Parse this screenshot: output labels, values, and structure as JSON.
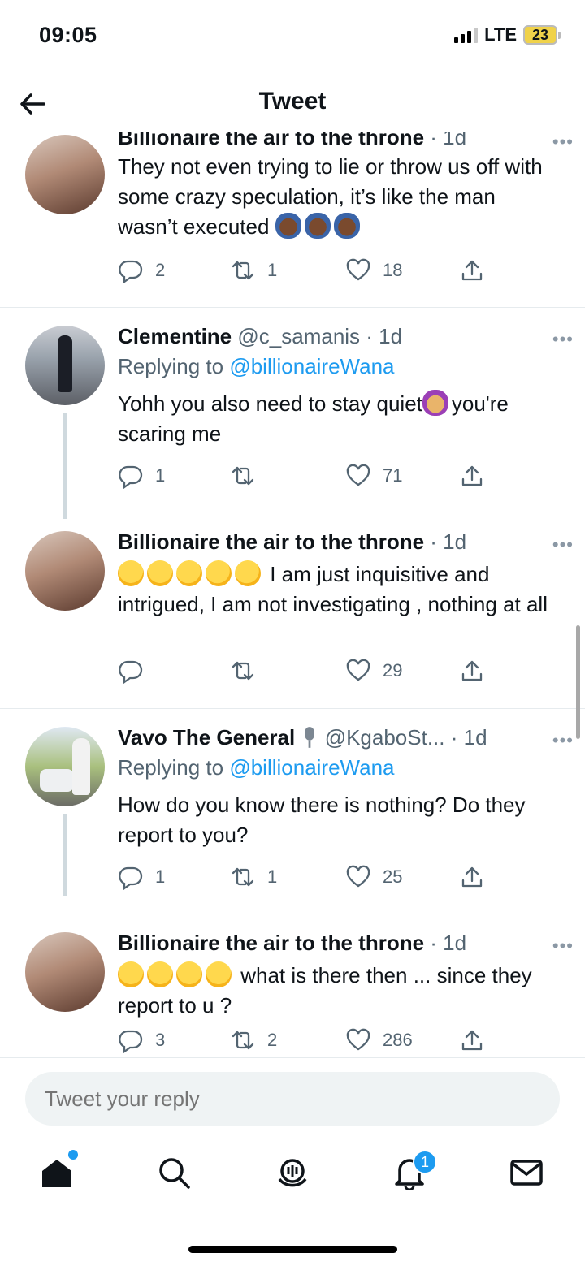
{
  "status_bar": {
    "time": "09:05",
    "network": "LTE",
    "battery": "23"
  },
  "header": {
    "title": "Tweet"
  },
  "tweets": [
    {
      "name": "Billionaire the air to the throne",
      "handle": "",
      "time": "· 1d",
      "replying_to_label": "",
      "replying_to_handle": "",
      "text": "They not even trying to lie or throw us off with some crazy speculation, it’s like the man wasn’t executed",
      "replies": "2",
      "retweets": "1",
      "likes": "18"
    },
    {
      "name": "Clementine",
      "handle": "@c_samanis",
      "time": "· 1d",
      "replying_to_label": "Replying to",
      "replying_to_handle": "@billionaireWana",
      "text_before": "Yohh you also need to stay quiet",
      "text_after": "you're scaring me",
      "replies": "1",
      "retweets": "",
      "likes": "71"
    },
    {
      "name": "Billionaire the air to the throne",
      "handle": "",
      "time": "· 1d",
      "text": "I am just inquisitive and intrigued, I am not investigating , nothing at all",
      "replies": "",
      "retweets": "",
      "likes": "29"
    },
    {
      "name": "Vavo The General",
      "handle": "@KgaboSt...",
      "time": "· 1d",
      "replying_to_label": "Replying to",
      "replying_to_handle": "@billionaireWana",
      "text": "How do you know there is nothing? Do they report to you?",
      "replies": "1",
      "retweets": "1",
      "likes": "25"
    },
    {
      "name": "Billionaire the air to the throne",
      "handle": "",
      "time": "· 1d",
      "text": "what is there then ... since they report to u ?",
      "replies": "3",
      "retweets": "2",
      "likes": "286"
    }
  ],
  "more_label": "•••",
  "reply_placeholder": "Tweet your reply",
  "tab_bar": {
    "notifications_badge": "1"
  },
  "icons": [
    "back-arrow-icon",
    "reply-icon",
    "retweet-icon",
    "like-icon",
    "share-icon",
    "home-icon",
    "search-icon",
    "spaces-icon",
    "notifications-icon",
    "messages-icon"
  ],
  "colors": {
    "accent": "#1d9bf0",
    "text": "#0f1419",
    "secondary": "#536471"
  }
}
